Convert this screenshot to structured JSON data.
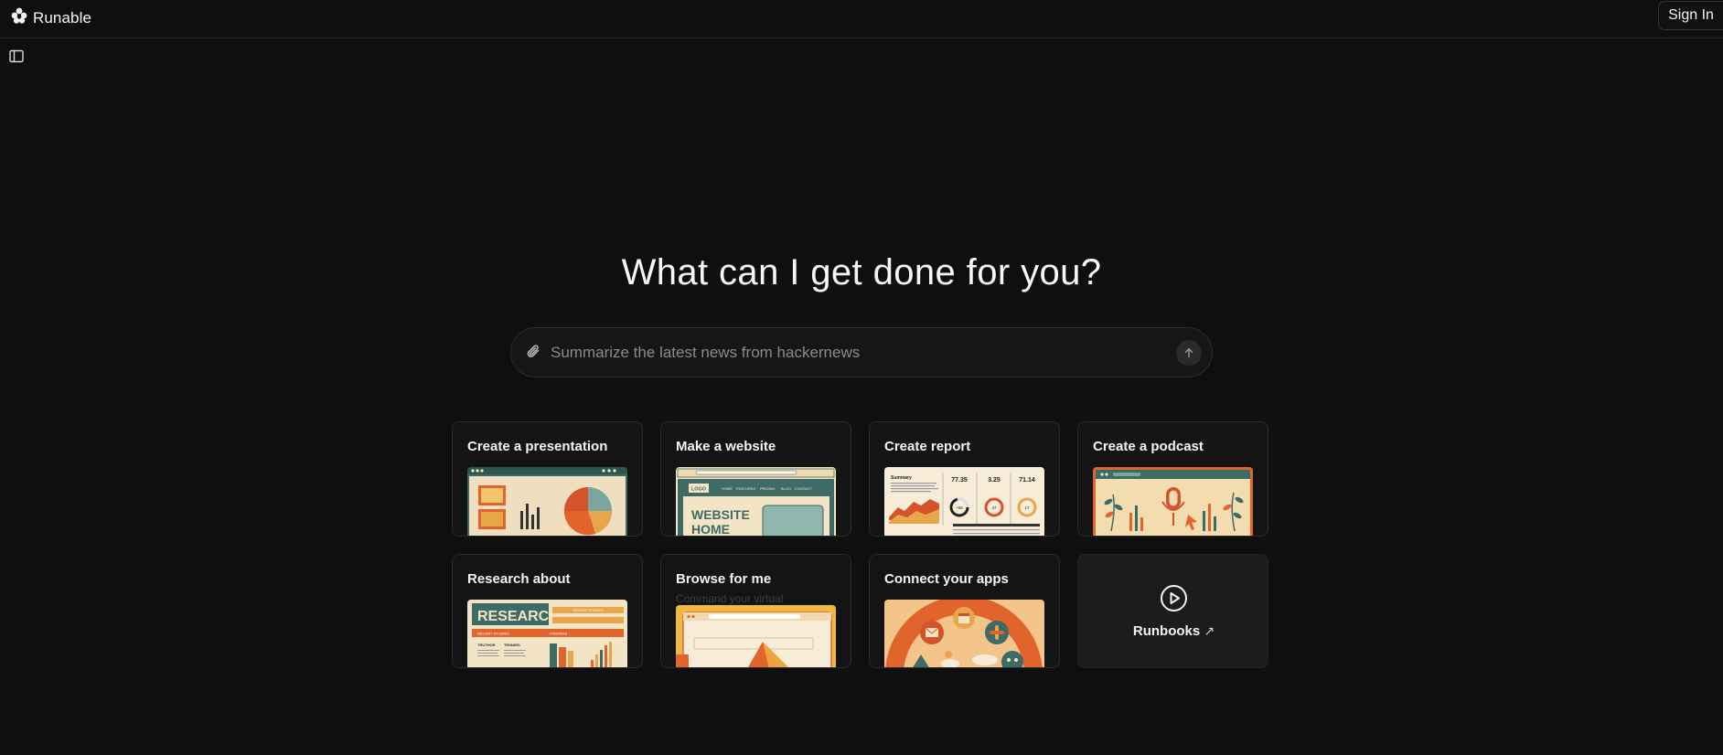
{
  "app": {
    "name": "Runable"
  },
  "header": {
    "signin_label": "Sign In"
  },
  "hero": {
    "title": "What can I get done for you?"
  },
  "search": {
    "placeholder": "Summarize the latest news from hackernews",
    "value": ""
  },
  "cards": [
    {
      "title": "Create a presentation"
    },
    {
      "title": "Make a website",
      "thumb_text": [
        "LOGO",
        "HOME",
        "FEATURES",
        "PRICING",
        "BLOG",
        "CONTACT",
        "WEBSITE",
        "HOME"
      ]
    },
    {
      "title": "Create report",
      "thumb_text": [
        "Summary",
        "77.35",
        "3.25",
        "71.14",
        "+56",
        "47",
        "17"
      ]
    },
    {
      "title": "Create a podcast"
    },
    {
      "title": "Research about",
      "thumb_text": [
        "RESEARCH",
        "RECENT STUDIES",
        "FINDINGS",
        "TRUTHOR",
        "TENNEEL"
      ]
    },
    {
      "title": "Browse for me",
      "subtitle": "Command your virtual"
    },
    {
      "title": "Connect your apps"
    }
  ],
  "runbooks": {
    "label": "Runbooks",
    "arrow": "↗"
  },
  "icons": {
    "logo": "runable-logo-icon",
    "sidebar": "sidebar-toggle-icon",
    "attach": "paperclip-icon",
    "send": "arrow-up-icon",
    "runbooks": "play-circle-icon"
  },
  "colors": {
    "background": "#0f0f0f",
    "card": "#141414",
    "border": "#2a2a2a",
    "runbooks_card": "#1b1c1d",
    "accent_orange": "#e0642b",
    "accent_teal": "#3e6b66",
    "cream": "#f3e4c6"
  }
}
